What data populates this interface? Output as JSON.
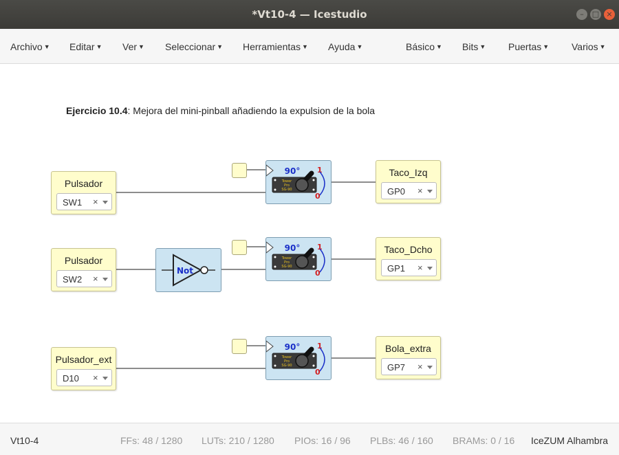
{
  "window": {
    "title": "*Vt10-4 — Icestudio",
    "min_glyph": "–",
    "max_glyph": "□",
    "close_glyph": "×"
  },
  "menubar": {
    "left": [
      "Archivo",
      "Editar",
      "Ver",
      "Seleccionar",
      "Herramientas",
      "Ayuda"
    ],
    "right": [
      "Básico",
      "Bits",
      "Puertas",
      "Varios"
    ]
  },
  "canvas": {
    "comment_bold": "Ejercicio 10.4",
    "comment_text": ": Mejora del mini-pinball añadiendo la expulsion de la bola",
    "inputs": [
      {
        "label": "Pulsador",
        "value": "SW1"
      },
      {
        "label": "Pulsador",
        "value": "SW2"
      },
      {
        "label": "Pulsador_ext",
        "value": "D10"
      }
    ],
    "outputs": [
      {
        "label": "Taco_Izq",
        "value": "GP0"
      },
      {
        "label": "Taco_Dcho",
        "value": "GP1"
      },
      {
        "label": "Bola_extra",
        "value": "GP7"
      }
    ],
    "clear_glyph": "×",
    "not_label": "Not",
    "servo": {
      "angle": "90°",
      "high": "1",
      "low": "0",
      "chip_lines": [
        "Tower",
        "Pro",
        "SG-90"
      ]
    }
  },
  "statusbar": {
    "project": "Vt10-4",
    "ffs": "FFs:  48 / 1280",
    "luts": "LUTs:  210 / 1280",
    "pios": "PIOs:  16 / 96",
    "plbs": "PLBs:  46 / 160",
    "brams": "BRAMs:  0 / 16",
    "board": "IceZUM Alhambra"
  },
  "colors": {
    "io_block": "#fffdcc",
    "logic_block": "#cce4f2",
    "angle_text": "#1a2fc8",
    "level_text": "#d42020",
    "close_button": "#e8603a"
  }
}
